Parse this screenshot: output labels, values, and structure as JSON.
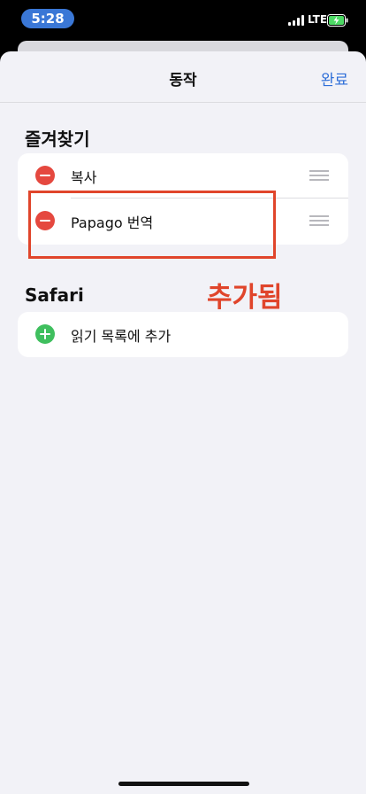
{
  "status_bar": {
    "time": "5:28",
    "network": "LTE",
    "time_pill_color": "#3a77d6",
    "battery_charging": true
  },
  "nav": {
    "title": "동작",
    "done_label": "완료",
    "accent_color": "#2f6fd8"
  },
  "favorites": {
    "title": "즐겨찾기",
    "items": [
      {
        "label": "복사",
        "action_icon": "remove-circle-icon",
        "reorder_icon": "drag-handle-icon"
      },
      {
        "label": "Papago 번역",
        "action_icon": "remove-circle-icon",
        "reorder_icon": "drag-handle-icon"
      }
    ]
  },
  "safari": {
    "title": "Safari",
    "items": [
      {
        "label": "읽기 목록에 추가",
        "action_icon": "add-circle-icon"
      }
    ]
  },
  "annotation": {
    "text": "추가됨",
    "color": "#e0452b"
  },
  "colors": {
    "remove": "#e5483f",
    "add": "#3fbf5e",
    "background": "#f2f2f7"
  }
}
